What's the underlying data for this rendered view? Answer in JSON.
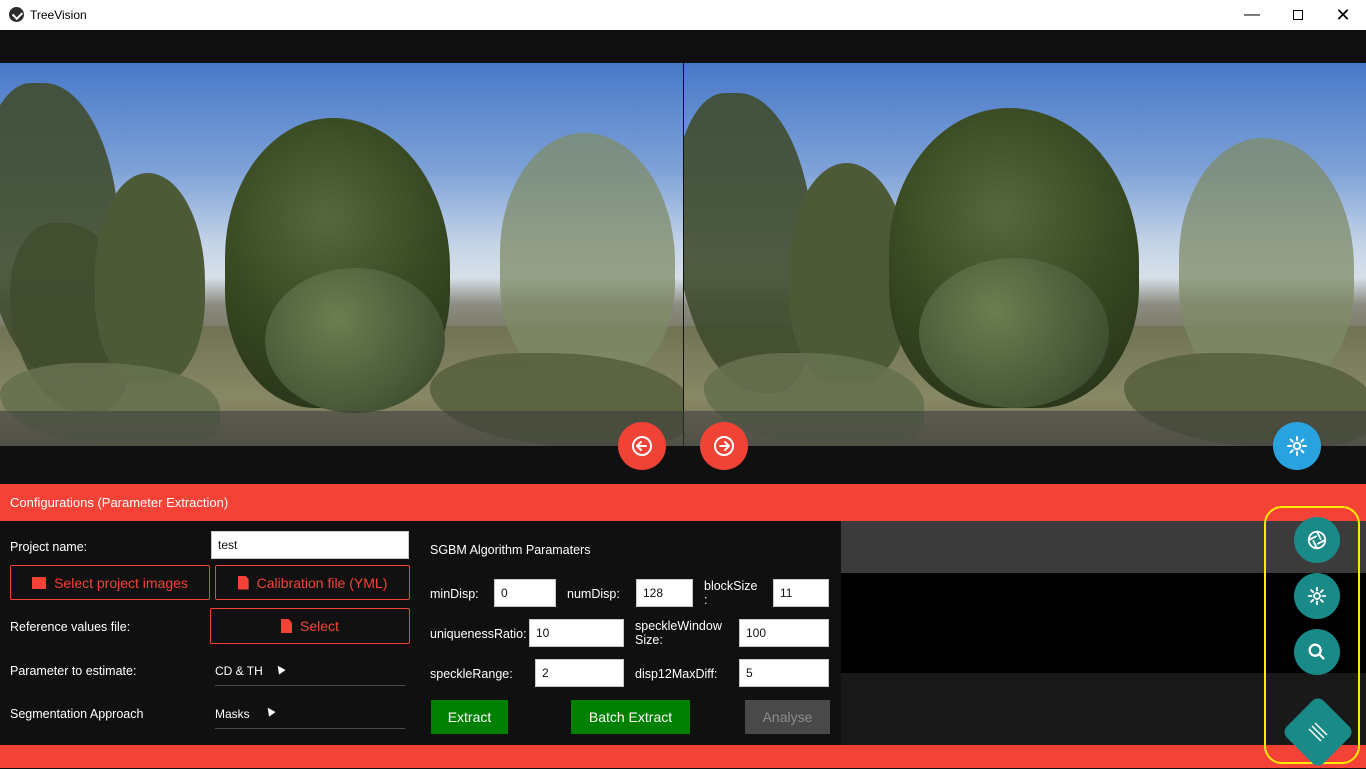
{
  "window": {
    "title": "TreeVision",
    "minimize_icon": "minimize-icon",
    "maximize_icon": "maximize-icon",
    "close_icon": "close-icon"
  },
  "viewer": {
    "left_image_alt": "stereo-left-photo",
    "right_image_alt": "stereo-right-photo",
    "prev_icon": "arrow-left-circle-icon",
    "next_icon": "arrow-right-circle-icon",
    "settings_icon": "settings-cog-icon"
  },
  "config": {
    "header": "Configurations (Parameter Extraction)",
    "project_name_label": "Project name:",
    "project_name_value": "test",
    "select_images_label": "Select project images",
    "calibration_label": "Calibration file (YML)",
    "reference_label": "Reference values file:",
    "reference_button": "Select",
    "parameter_label": "Parameter to estimate:",
    "parameter_value": "CD & TH",
    "segmentation_label": "Segmentation Approach",
    "segmentation_value": "Masks"
  },
  "sgbm": {
    "title": "SGBM Algorithm Paramaters",
    "minDisp_label": "minDisp:",
    "minDisp_value": "0",
    "numDisp_label": "numDisp:",
    "numDisp_value": "128",
    "blockSize_label_1": "blockSize",
    "blockSize_label_2": ":",
    "blockSize_value": "11",
    "uniqueness_label": "uniquenessRatio:",
    "uniqueness_value": "10",
    "speckleWindow_label_1": "speckleWindow",
    "speckleWindow_label_2": "Size:",
    "speckleWindow_value": "100",
    "speckleRange_label": "speckleRange:",
    "speckleRange_value": "2",
    "disp12_label": "disp12MaxDiff:",
    "disp12_value": "5"
  },
  "actions": {
    "extract": "Extract",
    "batch_extract": "Batch Extract",
    "analyse": "Analyse"
  },
  "fab_menu": {
    "camera_icon": "camera-shutter-icon",
    "settings_icon": "gear-icon",
    "search_icon": "search-icon",
    "menu_icon": "menu-lines-icon"
  },
  "colors": {
    "accent_red": "#f44336",
    "teal": "#1a8a88",
    "green": "#008000",
    "blue": "#29a3e0",
    "highlight": "#ffeb00"
  }
}
